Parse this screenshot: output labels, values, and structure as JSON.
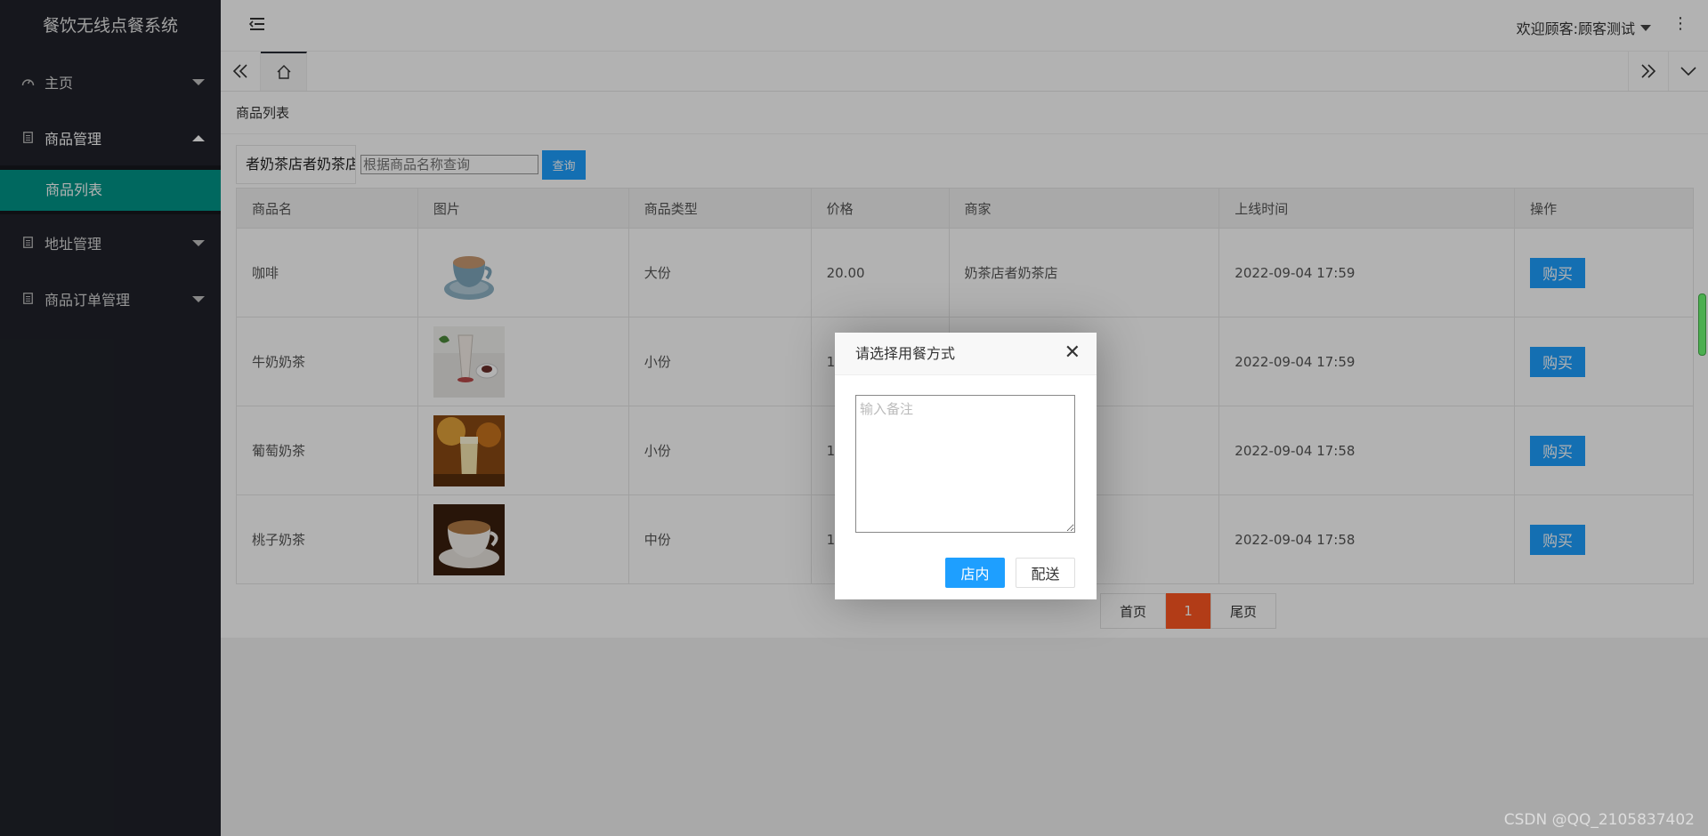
{
  "app": {
    "title": "餐饮无线点餐系统"
  },
  "sidebar": {
    "items": [
      {
        "label": "主页",
        "icon": "dashboard-icon"
      },
      {
        "label": "商品管理",
        "icon": "document-icon"
      },
      {
        "label": "地址管理",
        "icon": "document-icon"
      },
      {
        "label": "商品订单管理",
        "icon": "document-icon"
      }
    ],
    "submenu": {
      "label": "商品列表"
    }
  },
  "header": {
    "user": "欢迎顾客:顾客测试"
  },
  "page": {
    "title": "商品列表",
    "shop_label": "者奶茶店者奶茶店",
    "search_placeholder": "根据商品名称查询",
    "search_button": "查询"
  },
  "table": {
    "headers": [
      "商品名",
      "图片",
      "商品类型",
      "价格",
      "商家",
      "上线时间",
      "操作"
    ],
    "rows": [
      {
        "name": "咖啡",
        "type": "大份",
        "price": "20.00",
        "shop": "奶茶店者奶茶店",
        "time": "2022-09-04 17:59",
        "action": "购买"
      },
      {
        "name": "牛奶奶茶",
        "type": "小份",
        "price": "1",
        "shop": "",
        "time": "2022-09-04 17:59",
        "action": "购买"
      },
      {
        "name": "葡萄奶茶",
        "type": "小份",
        "price": "1",
        "shop": "",
        "time": "2022-09-04 17:58",
        "action": "购买"
      },
      {
        "name": "桃子奶茶",
        "type": "中份",
        "price": "1",
        "shop": "",
        "time": "2022-09-04 17:58",
        "action": "购买"
      }
    ]
  },
  "pager": {
    "first": "首页",
    "current": "1",
    "last": "尾页"
  },
  "dialog": {
    "title": "请选择用餐方式",
    "placeholder": "输入备注",
    "dine_in": "店内",
    "delivery": "配送"
  },
  "watermark": "CSDN @QQ_2105837402",
  "colors": {
    "sidebar": "#20222a",
    "accent": "#009688",
    "button": "#1e9fff",
    "pager_current": "#ff5722"
  }
}
